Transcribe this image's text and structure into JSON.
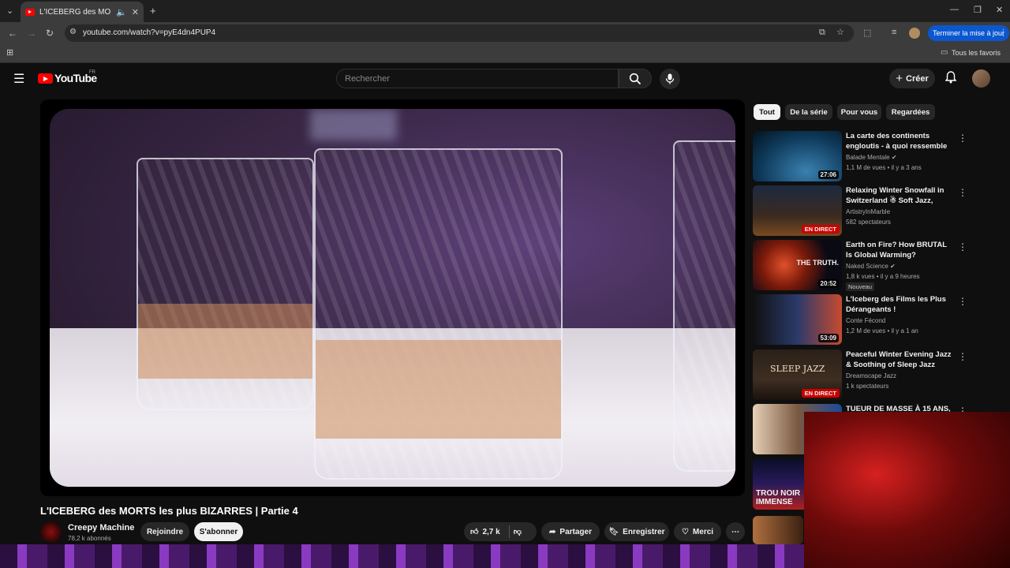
{
  "browser": {
    "tab_title": "L'ICEBERG des MORTS les p",
    "url": "youtube.com/watch?v=pyE4dn4PUP4",
    "update_button": "Terminer la mise à jour",
    "bookmarks_label": "Tous les favoris"
  },
  "header": {
    "logo_text": "YouTube",
    "logo_country": "FR",
    "search_placeholder": "Rechercher",
    "create_label": "Créer"
  },
  "video": {
    "title": "L'ICEBERG des MORTS les plus BIZARRES | Partie 4",
    "channel_name": "Creepy Machine",
    "subscribers": "78,2 k abonnés",
    "join_label": "Rejoindre",
    "subscribe_label": "S'abonner",
    "likes": "2,7 k",
    "share_label": "Partager",
    "save_label": "Enregistrer",
    "thanks_label": "Merci"
  },
  "filters": [
    "Tout",
    "De la série",
    "Pour vous",
    "Regardées"
  ],
  "recommendations": [
    {
      "title": "La carte des continents engloutis - à quoi ressemble la...",
      "channel": "Balade Mentale",
      "meta": "1,1 M de vues • il y a 3 ans",
      "duration": "27:06"
    },
    {
      "title": "Relaxing Winter Snowfall in Switzerland ☃ Soft Jazz, Coz...",
      "channel": "ArtistryInMarble",
      "meta": "582 spectateurs",
      "live": "EN DIRECT"
    },
    {
      "title": "Earth on Fire? How BRUTAL Is Global Warming?",
      "channel": "Naked Science",
      "meta": "1,8 k vues • il y a 9 heures",
      "duration": "20:52",
      "badge": "Nouveau",
      "thumb_text": "THE TRUTH."
    },
    {
      "title": "L'Iceberg des Films les Plus Dérangeants !",
      "channel": "Conte Fécond",
      "meta": "1,2 M de vues • il y a 1 an",
      "duration": "53:09"
    },
    {
      "title": "Peaceful Winter Evening Jazz & Soothing of Sleep Jazz Piano ...",
      "channel": "Dreamscape Jazz",
      "meta": "1 k spectateurs",
      "live": "EN DIRECT",
      "thumb_text": "SLEEP JAZZ"
    },
    {
      "title": "TUEUR DE MASSE À 15 ANS,"
    },
    {
      "thumb_text": "TROU NOIR IMMENSE"
    }
  ]
}
